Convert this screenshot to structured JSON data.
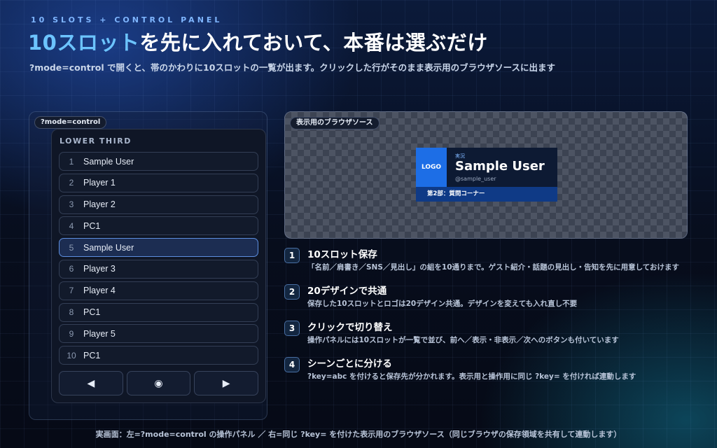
{
  "header": {
    "kicker": "10 SLOTS + CONTROL PANEL",
    "title_accent": "10スロット",
    "title_rest": "を先に入れておいて、本番は選ぶだけ",
    "subtitle": "?mode=control で開くと、帯のかわりに10スロットの一覧が出ます。クリックした行がそのまま表示用のブラウザソースに出ます"
  },
  "control_panel": {
    "mode_tag": "?mode=control",
    "section_label": "LOWER THIRD",
    "slots": [
      {
        "num": "1",
        "label": "Sample User"
      },
      {
        "num": "2",
        "label": "Player 1"
      },
      {
        "num": "3",
        "label": "Player 2"
      },
      {
        "num": "4",
        "label": "PC1"
      },
      {
        "num": "5",
        "label": "Sample User"
      },
      {
        "num": "6",
        "label": "Player 3"
      },
      {
        "num": "7",
        "label": "Player 4"
      },
      {
        "num": "8",
        "label": "PC1"
      },
      {
        "num": "9",
        "label": "Player 5"
      },
      {
        "num": "10",
        "label": "PC1"
      }
    ],
    "active_slot": "5",
    "controls": {
      "prev": "◀",
      "toggle": "◉",
      "next": "▶"
    }
  },
  "preview": {
    "tag": "表示用のブラウザソース",
    "lower_third": {
      "logo": "LOGO",
      "role": "実況",
      "name": "Sample User",
      "sns": "@sample_user",
      "headline": "第2部：質問コーナー"
    }
  },
  "features": [
    {
      "num": "1",
      "title": "10スロット保存",
      "desc": "「名前／肩書き／SNS／見出し」の組を10通りまで。ゲスト紹介・話題の見出し・告知を先に用意しておけます"
    },
    {
      "num": "2",
      "title": "20デザインで共通",
      "desc": "保存した10スロットとロゴは20デザイン共通。デザインを変えても入れ直し不要"
    },
    {
      "num": "3",
      "title": "クリックで切り替え",
      "desc": "操作パネルには10スロットが一覧で並び、前へ／表示・非表示／次へのボタンも付いています"
    },
    {
      "num": "4",
      "title": "シーンごとに分ける",
      "desc": "?key=abc を付けると保存先が分かれます。表示用と操作用に同じ ?key= を付ければ連動します"
    }
  ],
  "footer": "実画面：左=?mode=control の操作パネル ／ 右=同じ ?key= を付けた表示用のブラウザソース（同じブラウザの保存領域を共有して連動します）",
  "colors": {
    "accent": "#6cc4ff",
    "logo_blue": "#1d6ee6",
    "bar_blue": "#0f3a86",
    "active_border": "#5d8fe0"
  }
}
